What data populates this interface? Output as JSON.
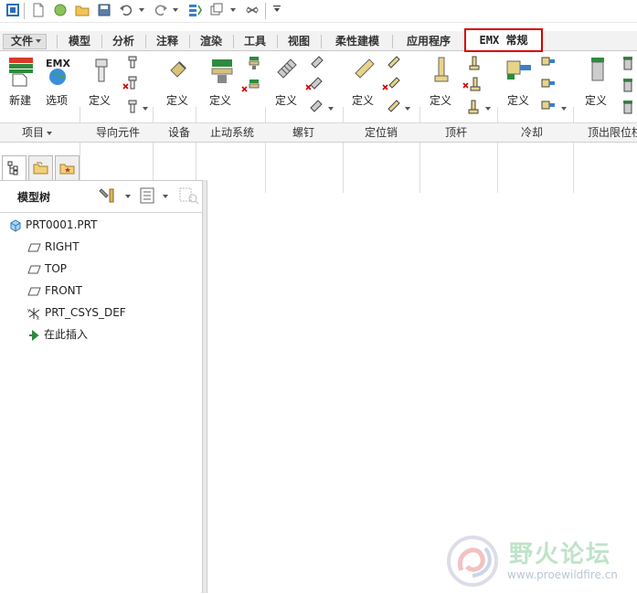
{
  "quick_access": {
    "icons": [
      "app-icon",
      "new-file-icon",
      "open-sphere-icon",
      "open-folder-icon",
      "save-icon",
      "undo-icon",
      "redo-icon",
      "regenerate-icon",
      "windows-icon",
      "close-window-icon",
      "customize-icon"
    ]
  },
  "tabs": [
    {
      "label": "文件"
    },
    {
      "label": "模型"
    },
    {
      "label": "分析"
    },
    {
      "label": "注释"
    },
    {
      "label": "渲染"
    },
    {
      "label": "工具"
    },
    {
      "label": "视图"
    },
    {
      "label": "柔性建模"
    },
    {
      "label": "应用程序"
    },
    {
      "label": "EMX 常规"
    }
  ],
  "ribbon": {
    "buttons": [
      {
        "label": "新建"
      },
      {
        "label": "选项"
      },
      {
        "label": "定义"
      },
      {
        "label": "定义"
      },
      {
        "label": "定义"
      },
      {
        "label": "定义"
      },
      {
        "label": "定义"
      },
      {
        "label": "定义"
      },
      {
        "label": "定义"
      },
      {
        "label": "定义"
      }
    ],
    "groups": [
      {
        "label": "项目"
      },
      {
        "label": "导向元件"
      },
      {
        "label": "设备"
      },
      {
        "label": "止动系统"
      },
      {
        "label": "螺钉"
      },
      {
        "label": "定位销"
      },
      {
        "label": "顶杆"
      },
      {
        "label": "冷却"
      },
      {
        "label": "顶出限位柱"
      }
    ]
  },
  "panel": {
    "title": "模型树",
    "items": [
      {
        "label": "PRT0001.PRT",
        "icon": "part-icon"
      },
      {
        "label": "RIGHT",
        "icon": "datum-plane-icon"
      },
      {
        "label": "TOP",
        "icon": "datum-plane-icon"
      },
      {
        "label": "FRONT",
        "icon": "datum-plane-icon"
      },
      {
        "label": "PRT_CSYS_DEF",
        "icon": "csys-icon"
      },
      {
        "label": "在此插入",
        "icon": "insert-arrow-icon"
      }
    ]
  },
  "watermark": {
    "title": "野火论坛",
    "url": "www.proewildfire.cn"
  },
  "colors": {
    "accent": "#d40000",
    "watermark_green": "#bfe3c8"
  }
}
